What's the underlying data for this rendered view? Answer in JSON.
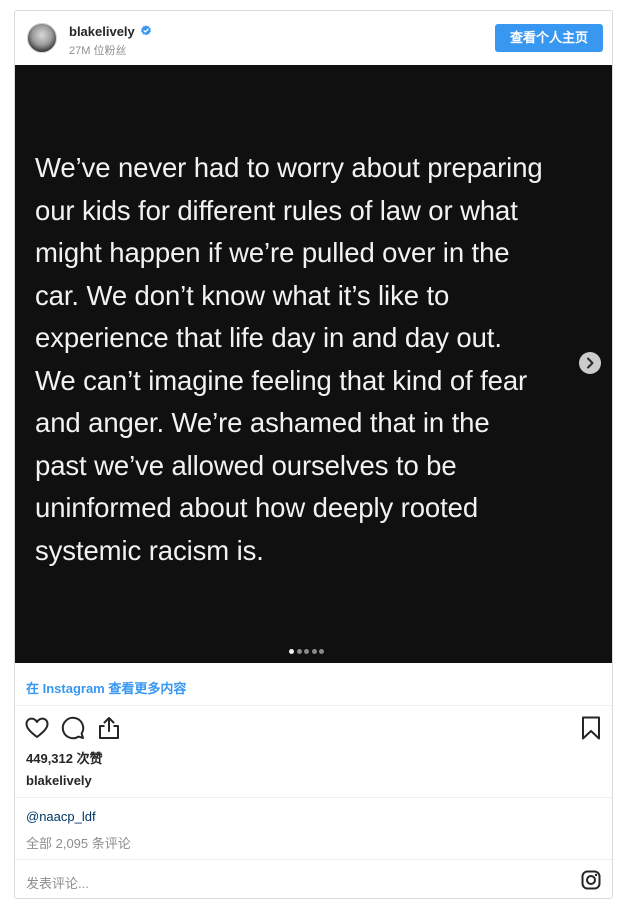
{
  "header": {
    "username": "blakelively",
    "followers": "27M 位粉丝",
    "profile_button": "查看个人主页"
  },
  "post": {
    "quote": "We’ve never had to worry about preparing\nour kids for different rules of law or what\nmight happen if we’re pulled over in the\ncar. We don’t know what it’s like to\nexperience that life day in and day out.\nWe can’t imagine feeling that kind of fear\nand anger. We’re ashamed that in the\npast we’ve allowed ourselves to be\nuninformed about how deeply rooted\nsystemic racism is.",
    "carousel": {
      "total_slides": 5,
      "current_slide": 1
    },
    "background_color": "#101010"
  },
  "view_more": "在 Instagram 查看更多内容",
  "actions": {
    "like_icon": "heart-icon",
    "comment_icon": "comment-icon",
    "share_icon": "share-icon",
    "save_icon": "bookmark-icon"
  },
  "likes": "449,312 次赞",
  "caption": {
    "username": "blakelively",
    "mention": "@naacp_ldf"
  },
  "comments": {
    "all_label": "全部 2,095 条评论",
    "input_placeholder": "发表评论..."
  },
  "colors": {
    "accent": "#3897f0",
    "verified": "#3897f0"
  }
}
